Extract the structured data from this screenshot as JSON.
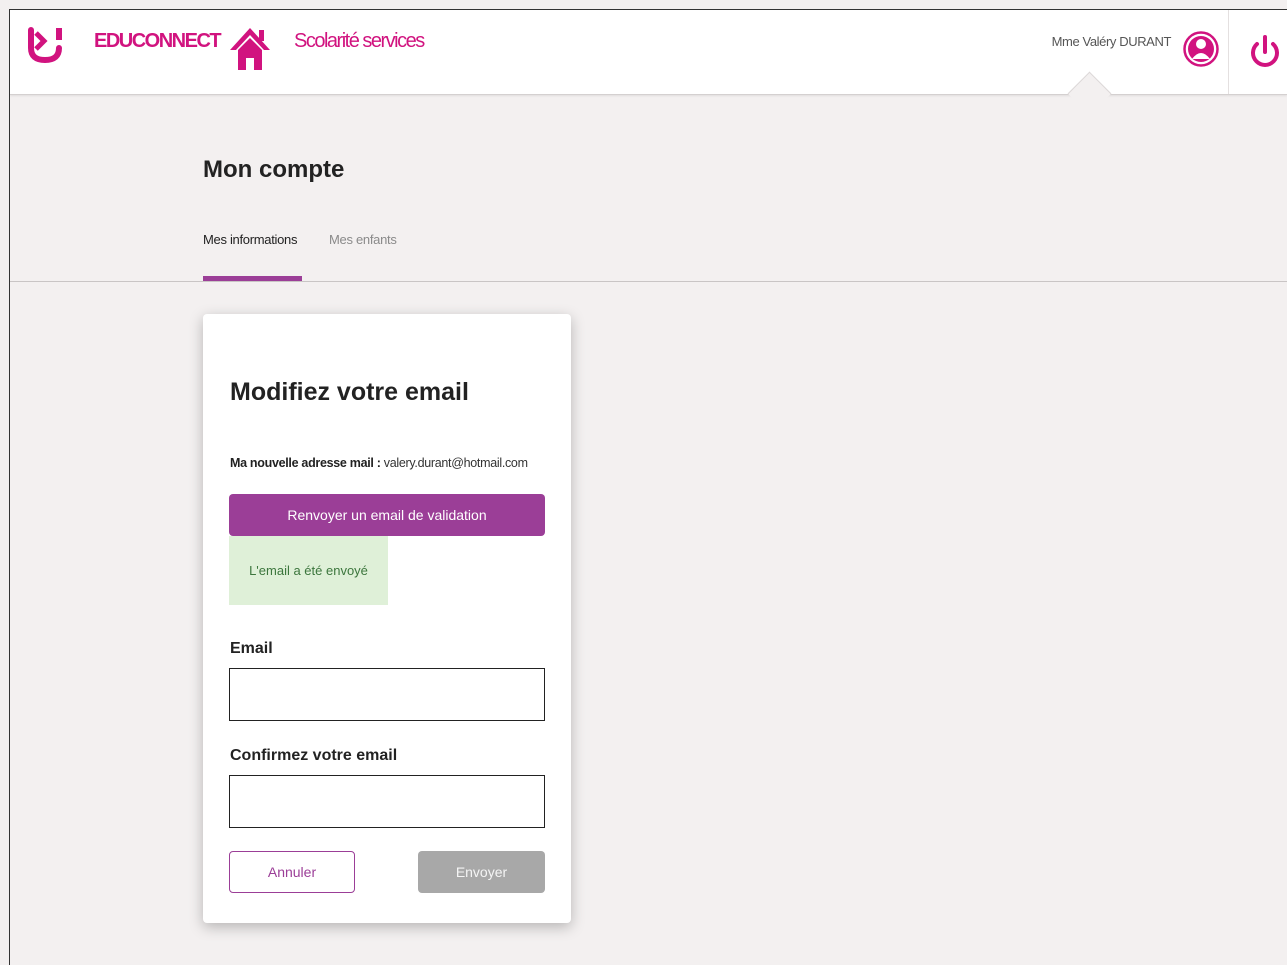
{
  "header": {
    "brand": "EDUCONNECT",
    "service": "Scolarité services",
    "user_name": "Mme Valéry DURANT",
    "brand_color": "#d1137f"
  },
  "page": {
    "title": "Mon compte",
    "tabs": [
      {
        "label": "Mes informations",
        "active": true
      },
      {
        "label": "Mes enfants",
        "active": false
      }
    ],
    "accent_color": "#9b3e97"
  },
  "card": {
    "title": "Modifiez votre email",
    "new_email_label": "Ma nouvelle adresse mail :",
    "new_email_value": "valery.durant@hotmail.com",
    "resend_button": "Renvoyer un email de validation",
    "alert_text": "L'email a été envoyé",
    "email_label": "Email",
    "email_value": "",
    "confirm_label": "Confirmez votre email",
    "confirm_value": "",
    "cancel_button": "Annuler",
    "send_button": "Envoyer"
  },
  "icons": [
    "educonnect-logo-icon",
    "home-icon",
    "user-avatar-icon",
    "power-icon"
  ]
}
